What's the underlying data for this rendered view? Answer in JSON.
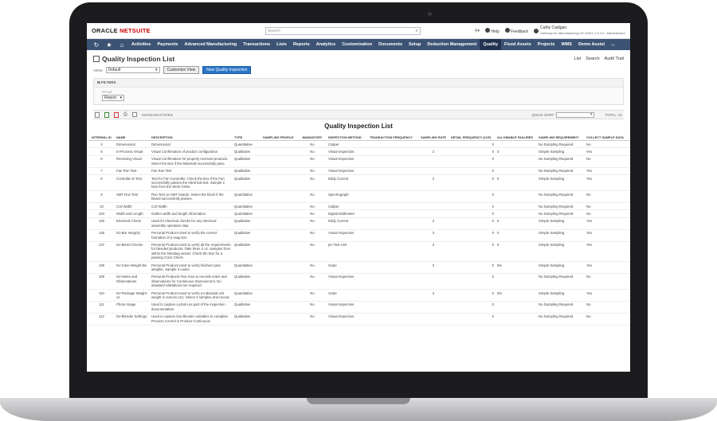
{
  "app": {
    "logo_a": "ORACLE",
    "logo_b": "NETSUITE",
    "search_placeholder": "Search",
    "help": "Help",
    "feedback": "Feedback",
    "user_name": "Cathy Cadigan",
    "user_role": "Gateway for Manufacturing US v2021.1.0.3.4 - Administrator"
  },
  "nav": {
    "items": [
      "Activities",
      "Payments",
      "Advanced Manufacturing",
      "Transactions",
      "Lists",
      "Reports",
      "Analytics",
      "Customization",
      "Documents",
      "Setup",
      "Deduction Management",
      "Quality",
      "Fixed Assets",
      "Projects",
      "WMS",
      "Demo Assist",
      "..."
    ],
    "active": "Quality"
  },
  "page": {
    "title": "Quality Inspection List",
    "links": [
      "List",
      "Search",
      "Audit Trail"
    ],
    "view_label": "VIEW",
    "view_value": "Default",
    "customize_label": "Customize View",
    "new_label": "New Quality Inspection",
    "filters_label": "FILTERS",
    "style_label": "STYLE",
    "style_value": "Report",
    "show_inactives": "SHOW INACTIVES",
    "quick_sort": "QUICK SORT",
    "total": "TOTAL: 21",
    "report_title": "Quality Inspection List"
  },
  "table": {
    "headers": [
      "INTERNAL ID",
      "NAME",
      "DESCRIPTION",
      "TYPE",
      "SAMPLING PROFILE",
      "MANDATORY",
      "INSPECTION METHOD",
      "TRANSACTION FREQUENCY",
      "SAMPLING RATE",
      "DETAIL FREQUENCY (1OF)",
      "ALLOWABLE FAILURES",
      "SAMPLING REQUIREMENT",
      "COLLECT SAMPLE DATA"
    ],
    "rows": [
      [
        "3",
        "Dimensional",
        "Dimensional",
        "Quantitative",
        "",
        "No",
        "Caliper",
        "",
        "",
        "0",
        "",
        "No Sampling Required",
        "No"
      ],
      [
        "5",
        "In-Process Visual",
        "Visual Confirmation of product configuration",
        "Qualitative",
        "",
        "No",
        "Visual Inspection",
        "",
        "2",
        "0",
        "0",
        "Simple Sampling",
        "Yes"
      ],
      [
        "6",
        "Receiving Visual",
        "Visual Confirmation for properly received products. Select the Box if the Materials successfully pass.",
        "Qualitative",
        "",
        "No",
        "Visual Inspection",
        "",
        "",
        "0",
        "",
        "No Sampling Required",
        "No"
      ],
      [
        "7",
        "Fan Run Test",
        "Fan Run Test",
        "Qualitative",
        "",
        "No",
        "Visual Inspection",
        "",
        "",
        "0",
        "",
        "No Sampling Required",
        "Yes"
      ],
      [
        "8",
        "Controller E-Test",
        "Test for Fan Controller. Check the Box if the Fan successfully passes the electrical test. Sample 2 fans from the Work Order.",
        "Qualitative",
        "",
        "No",
        "Eddy Current",
        "",
        "2",
        "0",
        "0",
        "Simple Sampling",
        "Yes"
      ],
      [
        "9",
        "SMT Run Test",
        "Run Test on SMT boards. Select the block if the Board successfully passes.",
        "Quantitative",
        "",
        "No",
        "Spectrograph",
        "",
        "",
        "0",
        "",
        "No Sampling Required",
        "No"
      ],
      [
        "10",
        "Coil Width",
        "Coil Width",
        "Quantitative",
        "",
        "No",
        "Caliper",
        "",
        "",
        "0",
        "",
        "No Sampling Required",
        "No"
      ],
      [
        "104",
        "Width and Length",
        "Gather width and length information",
        "Quantitative",
        "",
        "No",
        "Digital Multimeter",
        "",
        "",
        "0",
        "",
        "No Sampling Required",
        "No"
      ],
      [
        "126",
        "Electrical Check",
        "Used for electrical checks for any electrical assembly operation step",
        "Qualitative",
        "",
        "No",
        "Eddy Current",
        "",
        "2",
        "0",
        "0",
        "Simple Sampling",
        "Yes"
      ],
      [
        "136",
        "NJ-Bar Integrity",
        "Personal Product-Used to verify the correct formation of a soap bar",
        "Qualitative",
        "",
        "No",
        "Visual Inspection",
        "",
        "3",
        "0",
        "0",
        "Simple Sampling",
        "Yes"
      ],
      [
        "137",
        "NJ-Blend Checks",
        "Personal Product-Used to verify all the requirements for blended products. Take three 2 oz. samples from within the blending vessel. Check the Box for a passing Color Check.",
        "Qualitative",
        "",
        "No",
        "pH Test Unit",
        "",
        "3",
        "0",
        "0",
        "Simple Sampling",
        "Yes"
      ],
      [
        "108",
        "NJ-Case Weight-lbs",
        "Personal Product-Used to verify finished case weights. Sample 3 cases.",
        "Quantitative",
        "",
        "No",
        "Scale",
        "",
        "3",
        "0",
        "5%",
        "Simple Sampling",
        "Yes"
      ],
      [
        "109",
        "NJ-Notes and Observations",
        "Personal Products-Text Area to records notes and observations for Continuous Improvement. No standard validations are required.",
        "Qualitative",
        "",
        "No",
        "Visual Inspection",
        "",
        "",
        "0",
        "",
        "No Sampling Required",
        "No"
      ],
      [
        "110",
        "NJ-Package Weight-oz",
        "Personal Product-Used to verify a individual unit weight in ounces (oz). Select 3 samples and record.",
        "Quantitative",
        "",
        "No",
        "Scale",
        "",
        "3",
        "0",
        "5%",
        "Simple Sampling",
        "Yes"
      ],
      [
        "111",
        "Photo Image",
        "Used to capture a photo as part of the inspection documentation",
        "Qualitative",
        "",
        "No",
        "Visual Inspection",
        "",
        "",
        "0",
        "",
        "No Sampling Required",
        "No"
      ],
      [
        "112",
        "NJ-Blender Settings",
        "Used to capture key Blender variables to complete Process Control in Product Continuous",
        "Qualitative",
        "",
        "No",
        "Visual Inspection",
        "",
        "",
        "0",
        "",
        "No Sampling Required",
        "No"
      ]
    ]
  }
}
